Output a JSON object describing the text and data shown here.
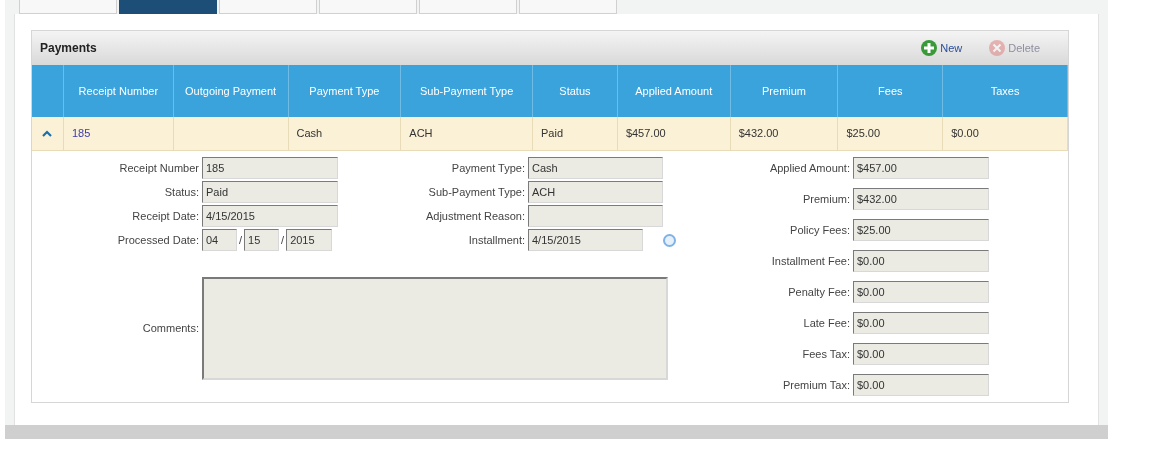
{
  "tabs": [
    {
      "selected": false
    },
    {
      "selected": true
    },
    {
      "selected": false
    },
    {
      "selected": false
    },
    {
      "selected": false
    },
    {
      "selected": false
    }
  ],
  "panel": {
    "title": "Payments",
    "buttons": [
      {
        "label": "New",
        "kind": "add",
        "disabled": false
      },
      {
        "label": "Delete",
        "kind": "delete",
        "disabled": true
      }
    ]
  },
  "table": {
    "columns": [
      "Receipt Number",
      "Outgoing Payment",
      "Payment Type",
      "Sub-Payment Type",
      "Status",
      "Applied Amount",
      "Premium",
      "Fees",
      "Taxes"
    ],
    "rows": [
      {
        "expanded": true,
        "cells": [
          "185",
          "",
          "Cash",
          "ACH",
          "Paid",
          "$457.00",
          "$432.00",
          "$25.00",
          "$0.00"
        ]
      }
    ]
  },
  "details": {
    "left_fields": [
      {
        "kind": "text",
        "label": "Receipt Number",
        "value": "185"
      },
      {
        "kind": "text",
        "label": "Status:",
        "value": "Paid"
      },
      {
        "kind": "text",
        "label": "Receipt Date:",
        "value": "4/15/2015"
      },
      {
        "kind": "date_parts",
        "label": "Processed Date:",
        "parts": [
          "04",
          "15",
          "2015"
        ],
        "separator": "/"
      }
    ],
    "middle_fields": [
      {
        "kind": "text",
        "label": "Payment Type:",
        "value": "Cash"
      },
      {
        "kind": "text",
        "label": "Sub-Payment Type:",
        "value": "ACH"
      },
      {
        "kind": "text",
        "label": "Adjustment Reason:"
      },
      {
        "kind": "date_picker",
        "label": "Installment:",
        "value": "4/15/2015"
      }
    ],
    "comments": {
      "label": "Comments:"
    },
    "right_fields": [
      {
        "kind": "text",
        "label": "Applied Amount:",
        "value": "$457.00"
      },
      {
        "kind": "text",
        "label": "Premium:",
        "value": "$432.00"
      },
      {
        "kind": "text",
        "label": "Policy Fees:",
        "value": "$25.00"
      },
      {
        "kind": "text",
        "label": "Installment Fee:",
        "value": "$0.00"
      },
      {
        "kind": "text",
        "label": "Penalty Fee:",
        "value": "$0.00"
      },
      {
        "kind": "text",
        "label": "Late Fee:",
        "value": "$0.00"
      },
      {
        "kind": "text",
        "label": "Fees Tax:",
        "value": "$0.00"
      },
      {
        "kind": "text",
        "label": "Premium Tax:",
        "value": "$0.00"
      }
    ]
  }
}
